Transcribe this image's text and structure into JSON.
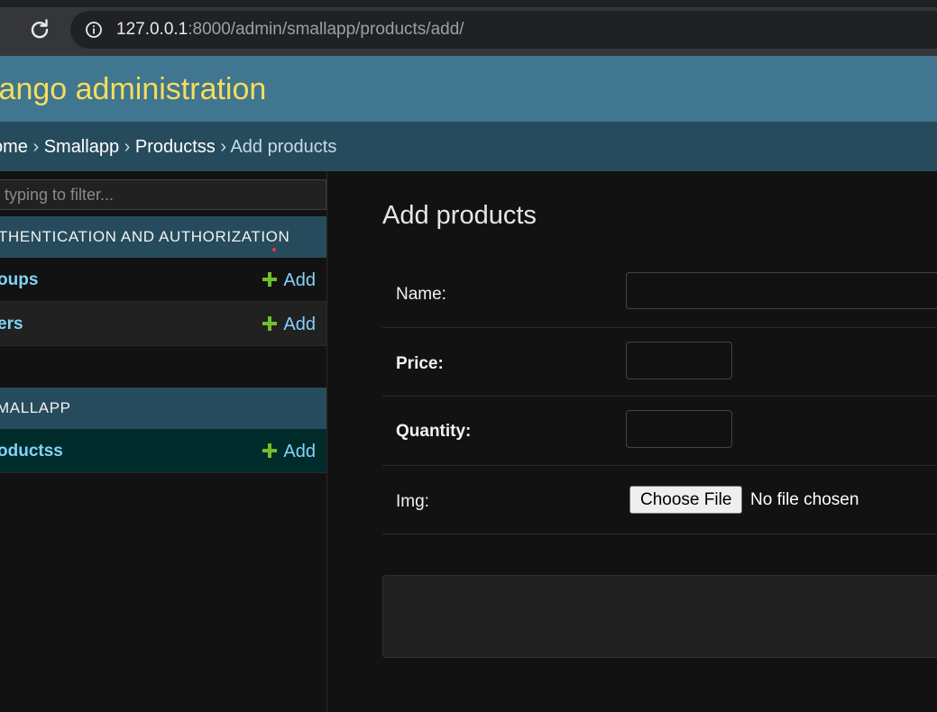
{
  "browser": {
    "url_host": "127.0.0.1",
    "url_rest": ":8000/admin/smallapp/products/add/"
  },
  "header": {
    "branding": "jango administration"
  },
  "breadcrumbs": {
    "home": "ome",
    "sep": " › ",
    "app": "Smallapp",
    "model": "Productss",
    "current": "Add products"
  },
  "sidebar": {
    "filter_placeholder": "typing to filter...",
    "modules": [
      {
        "caption": "THENTICATION AND AUTHORIZATION",
        "rows": [
          {
            "name": "oups",
            "add": "Add"
          },
          {
            "name": "ers",
            "add": "Add"
          }
        ]
      },
      {
        "caption": "MALLAPP",
        "rows": [
          {
            "name": "oductss",
            "add": "Add"
          }
        ]
      }
    ]
  },
  "content": {
    "title": "Add products",
    "fields": {
      "name": {
        "label": "Name:"
      },
      "price": {
        "label": "Price:"
      },
      "quantity": {
        "label": "Quantity:"
      },
      "img": {
        "label": "Img:",
        "button": "Choose File",
        "status": "No file chosen"
      }
    }
  },
  "colors": {
    "header_bg": "#417690",
    "breadcrumbs_bg": "#264b5d",
    "branding": "#f5dd5d",
    "link": "#81d4fa",
    "add_icon": "#70bf2b",
    "selected_row_bg": "#002b2b"
  }
}
